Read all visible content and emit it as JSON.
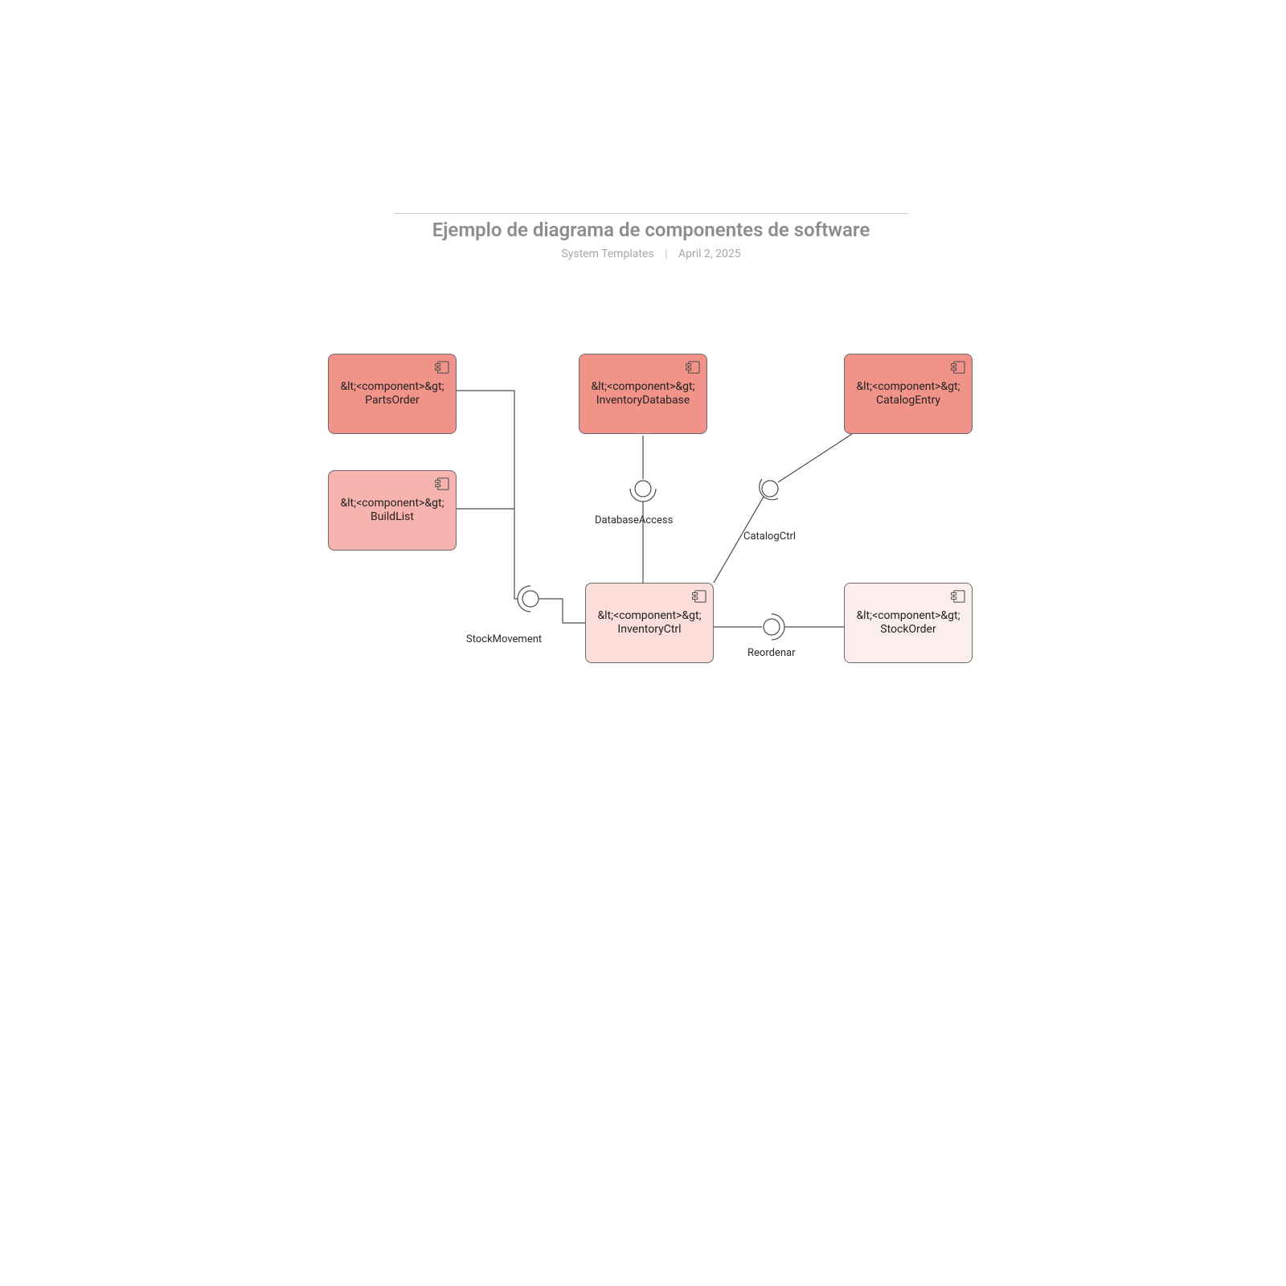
{
  "header": {
    "title": "Ejemplo de diagrama de componentes de software",
    "author": "System Templates",
    "date": "April 2, 2025"
  },
  "stereotype": "&lt;<component>&gt;",
  "components": {
    "partsOrder": "PartsOrder",
    "buildList": "BuildList",
    "inventoryDatabase": "InventoryDatabase",
    "catalogEntry": "CatalogEntry",
    "inventoryCtrl": "InventoryCtrl",
    "stockOrder": "StockOrder"
  },
  "interfaces": {
    "stockMovement": "StockMovement",
    "databaseAccess": "DatabaseAccess",
    "catalogCtrl": "CatalogCtrl",
    "reorder": "Reordenar"
  }
}
